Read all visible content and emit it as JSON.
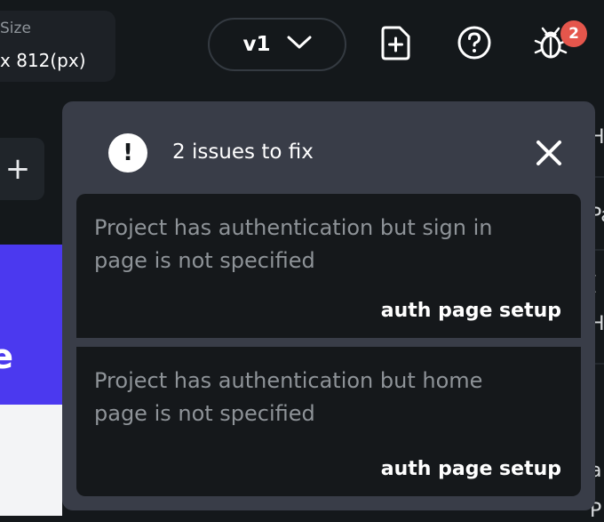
{
  "topbar": {
    "size_label": "Size",
    "size_value": "x 812(px)",
    "version": "v1",
    "icons": {
      "new_page": "new-page-icon",
      "help": "help-icon",
      "debug": "bug-icon"
    },
    "issue_count": "2"
  },
  "left": {
    "add_label": "+",
    "hero_title": "tle"
  },
  "right": {
    "fragments": [
      "H",
      "Pa",
      "[",
      "H",
      "",
      "a",
      "P"
    ]
  },
  "popover": {
    "title": "2 issues to fix",
    "alert_symbol": "!",
    "issues": [
      {
        "text": "Project has authentication but sign in page is not specified",
        "action": "auth page setup"
      },
      {
        "text": "Project has authentication but home page is not specified",
        "action": "auth page setup"
      }
    ]
  },
  "colors": {
    "background": "#14181b",
    "popover": "#393d48",
    "card": "#15181b",
    "accent": "#4b39ef",
    "badge": "#e5564c"
  }
}
